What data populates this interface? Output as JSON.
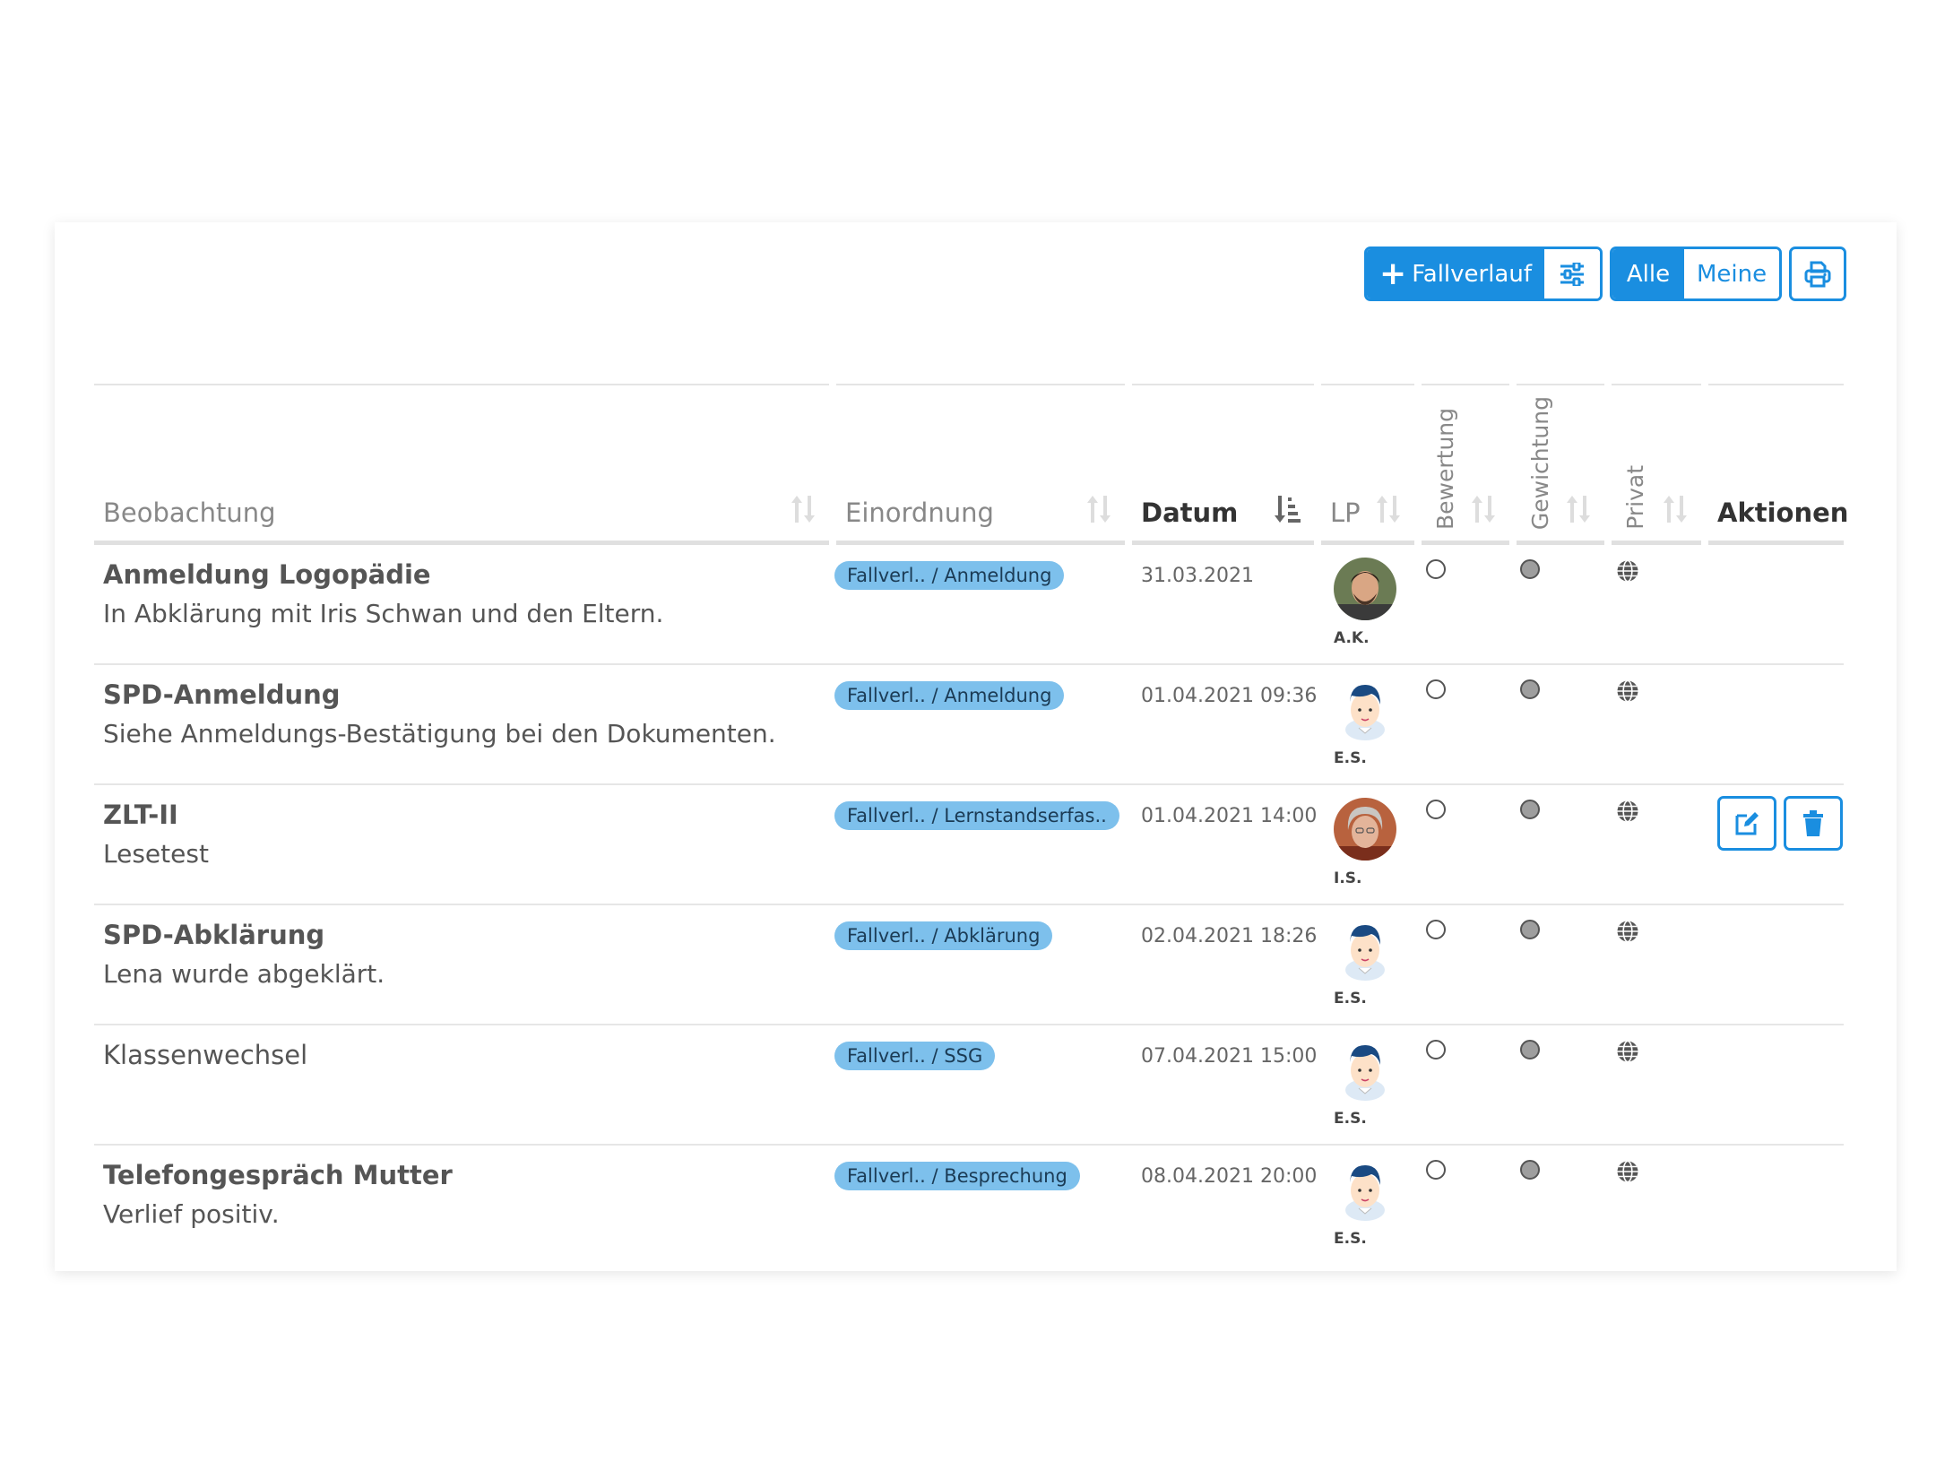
{
  "toolbar": {
    "add_label": "Fallverlauf",
    "filter_all": "Alle",
    "filter_mine": "Meine"
  },
  "columns": {
    "beobachtung": "Beobachtung",
    "einordnung": "Einordnung",
    "datum": "Datum",
    "lp": "LP",
    "bewertung": "Bewertung",
    "gewichtung": "Gewichtung",
    "privat": "Privat",
    "aktionen": "Aktionen"
  },
  "rows": [
    {
      "title": "Anmeldung Logopädie",
      "subtitle": "In Abklärung mit Iris Schwan und den Eltern.",
      "tag": "Fallverl.. / Anmeldung",
      "date": "31.03.2021",
      "initials": "A.K.",
      "avatar": "photo-man-avatar"
    },
    {
      "title": "SPD-Anmeldung",
      "subtitle": "Siehe Anmeldungs-Bestätigung bei den Dokumenten.",
      "tag": "Fallverl.. / Anmeldung",
      "date": "01.04.2021 09:36",
      "initials": "E.S.",
      "avatar": "cartoon-avatar"
    },
    {
      "title": "ZLT-II",
      "subtitle": "Lesetest",
      "tag": "Fallverl.. / Lernstandserfas..",
      "date": "01.04.2021 14:00",
      "initials": "I.S.",
      "avatar": "photo-woman-avatar"
    },
    {
      "title": "SPD-Abklärung",
      "subtitle": "Lena wurde abgeklärt.",
      "tag": "Fallverl.. / Abklärung",
      "date": "02.04.2021 18:26",
      "initials": "E.S.",
      "avatar": "cartoon-avatar"
    },
    {
      "title": "Klassenwechsel",
      "subtitle": "",
      "tag": "Fallverl.. / SSG",
      "date": "07.04.2021 15:00",
      "initials": "E.S.",
      "avatar": "cartoon-avatar"
    },
    {
      "title": "Telefongespräch Mutter",
      "subtitle": "Verlief positiv.",
      "tag": "Fallverl.. / Besprechung",
      "date": "08.04.2021 20:00",
      "initials": "E.S.",
      "avatar": "cartoon-avatar"
    }
  ],
  "colors": {
    "accent": "#1a8ee0",
    "tag_bg": "#7dc0ec"
  }
}
